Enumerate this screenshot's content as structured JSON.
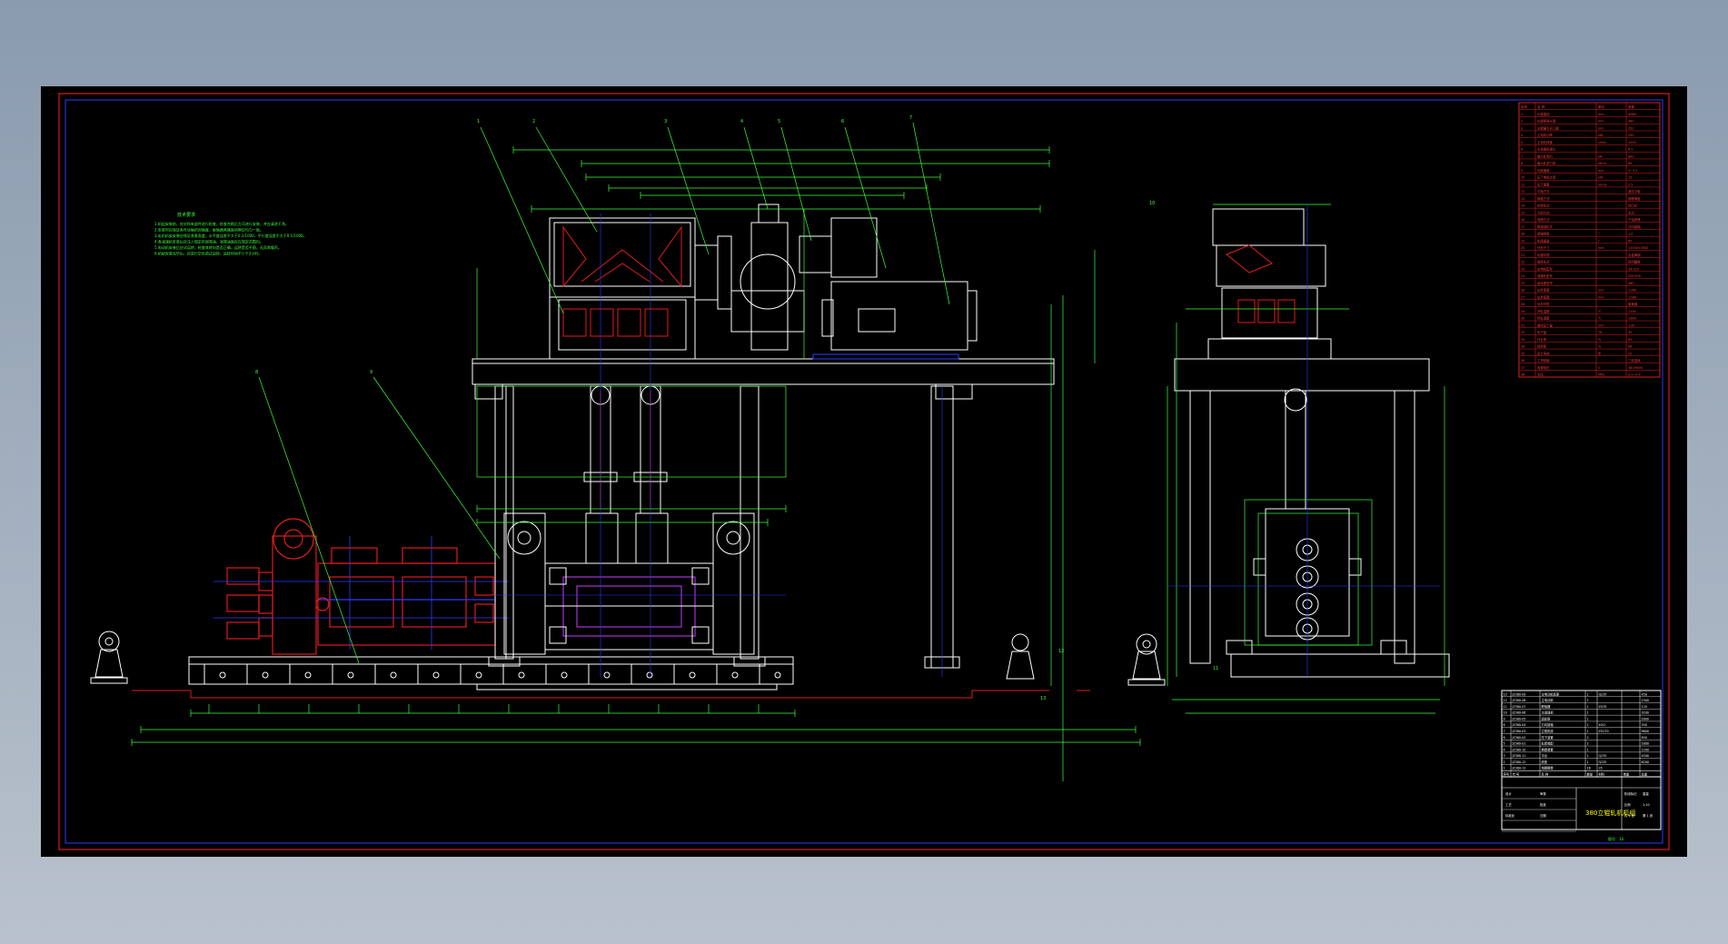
{
  "window": {
    "title": ""
  },
  "drawing": {
    "title_block_caption": "380立辊轧机机组",
    "sheet_note": "图号：16",
    "tech_notes_heading": "技术要求",
    "tech_notes": [
      "1.机组安装前，应对所有部件进行检查，检查合格后方可进行安装，并应清洗干净。",
      "2.安装时应保证各传动轴的同轴度，联轴器两端面间隙应均匀一致。",
      "3.轧机机架安装应保证其垂直度，水平度误差不大于0.1/1000，平行度误差不大于0.1/1000。",
      "4.各减速机安装后应注入规定的润滑油，润滑油面应在规定范围内。",
      "5.电动机安装后应试运转，检查其转向是否正确，运转是否平稳，无异常噪声。",
      "6.机组安装完毕后，应进行空负荷试运转，运转时间不少于2小时。"
    ],
    "parts_table_header": [
      "序号",
      "名  称",
      "单位",
      "参数"
    ],
    "parts_table_rows": [
      [
        "1",
        "轧辊直径",
        "mm",
        "Φ380"
      ],
      [
        "2",
        "轧辊辊身长度",
        "mm",
        "380"
      ],
      [
        "3",
        "轧辊最大开口度",
        "mm",
        "250"
      ],
      [
        "4",
        "主电机功率",
        "kW",
        "250"
      ],
      [
        "5",
        "主电机转速",
        "r/min",
        "1000"
      ],
      [
        "6",
        "主减速机速比",
        "",
        "8.5"
      ],
      [
        "7",
        "最大轧制力",
        "kN",
        "800"
      ],
      [
        "8",
        "最大轧制力矩",
        "kN·m",
        "60"
      ],
      [
        "9",
        "轧制速度",
        "m/s",
        "0~3.5"
      ],
      [
        "10",
        "压下电机功率",
        "kW",
        "15"
      ],
      [
        "11",
        "压下速度",
        "mm/s",
        "2.5"
      ],
      [
        "12",
        "平衡方式",
        "",
        "液压平衡"
      ],
      [
        "13",
        "换辊方式",
        "",
        "侧移换辊"
      ],
      [
        "14",
        "机架形式",
        "",
        "闭口式"
      ],
      [
        "15",
        "冷却方式",
        "",
        "水冷"
      ],
      [
        "16",
        "润滑方式",
        "",
        "干油润滑"
      ],
      [
        "17",
        "联接轴形式",
        "",
        "万向接轴"
      ],
      [
        "18",
        "接轴倾角",
        "°",
        "≤3"
      ],
      [
        "19",
        "机组重量",
        "t",
        "85"
      ],
      [
        "20",
        "外形尺寸",
        "mm",
        "12000×4500"
      ],
      [
        "21",
        "轧辊材质",
        "",
        "合金铸钢"
      ],
      [
        "22",
        "轴承形式",
        "",
        "四列圆锥"
      ],
      [
        "23",
        "主电机型号",
        "",
        "Z4-315"
      ],
      [
        "24",
        "减速机型号",
        "",
        "ZSY-500"
      ],
      [
        "25",
        "齿轮座型号",
        "",
        "380"
      ],
      [
        "26",
        "轧件宽度",
        "mm",
        "≤350"
      ],
      [
        "27",
        "轧件厚度",
        "mm",
        "≤180"
      ],
      [
        "28",
        "轧件材质",
        "",
        "碳素钢"
      ],
      [
        "29",
        "开轧温度",
        "℃",
        "1150"
      ],
      [
        "30",
        "终轧温度",
        "℃",
        "≥850"
      ],
      [
        "31",
        "道次压下量",
        "mm",
        "≤30"
      ],
      [
        "32",
        "年产量",
        "万t",
        "30"
      ],
      [
        "33",
        "作业率",
        "%",
        "85"
      ],
      [
        "34",
        "成材率",
        "%",
        "96"
      ],
      [
        "35",
        "设计寿命",
        "年",
        "20"
      ],
      [
        "36",
        "工作制度",
        "",
        "三班连续"
      ],
      [
        "37",
        "电源电压",
        "V",
        "380/6000"
      ],
      [
        "38",
        "水压",
        "MPa",
        "0.3~0.4"
      ]
    ],
    "bom_rows": [
      [
        "13",
        "JZ380-09",
        "主电动机底座",
        "1",
        "Q235",
        "",
        "450"
      ],
      [
        "12",
        "JZ380-08",
        "主电动机",
        "1",
        "",
        "",
        "2300"
      ],
      [
        "11",
        "JZ380-07",
        "联轴器",
        "1",
        "ZG35",
        "",
        "120"
      ],
      [
        "10",
        "JZ380-06",
        "主减速机",
        "1",
        "",
        "",
        "3200"
      ],
      [
        "9",
        "JZ380-05",
        "齿轮座",
        "1",
        "",
        "",
        "2800"
      ],
      [
        "8",
        "JZ380-04",
        "万向接轴",
        "2",
        "40Cr",
        "",
        "350"
      ],
      [
        "7",
        "JZ380-03",
        "立辊机座",
        "1",
        "ZG270",
        "",
        "9600"
      ],
      [
        "6",
        "JZ380-02",
        "压下装置",
        "2",
        "",
        "",
        "850"
      ],
      [
        "5",
        "JZ380-01",
        "轧辊装配",
        "2",
        "",
        "",
        "1800"
      ],
      [
        "4",
        "JZ380-10",
        "换辊装置",
        "1",
        "",
        "",
        "1200"
      ],
      [
        "3",
        "JZ380-11",
        "平台",
        "1",
        "Q235",
        "",
        "4500"
      ],
      [
        "2",
        "JZ380-12",
        "底座",
        "1",
        "Q235",
        "",
        "6200"
      ],
      [
        "1",
        "JZ380-13",
        "地脚螺栓",
        "16",
        "35",
        "",
        ""
      ]
    ],
    "bom_header": [
      "序号",
      "代  号",
      "名  称",
      "数量",
      "材料",
      "单重",
      "总重"
    ],
    "title_block_cells": [
      "设计",
      "审核",
      "工艺",
      "批准",
      "标准化",
      "日期",
      "阶段标记",
      "重量",
      "比例",
      "1:10",
      "共 1 张",
      "第 1 张"
    ],
    "part_callouts": [
      "1",
      "2",
      "3",
      "4",
      "5",
      "6",
      "7",
      "8",
      "9",
      "10",
      "11",
      "12",
      "13"
    ]
  }
}
